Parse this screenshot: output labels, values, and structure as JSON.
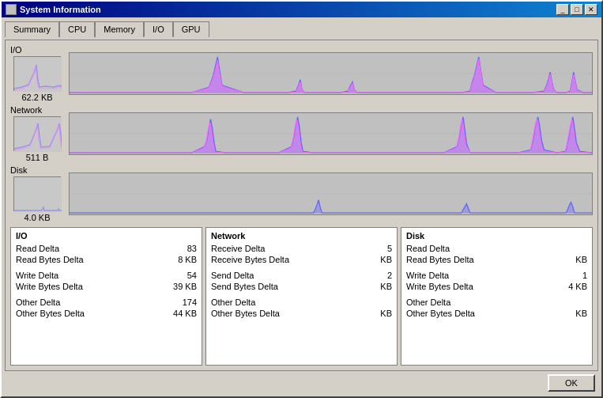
{
  "window": {
    "title": "System Information",
    "minimize_label": "0",
    "maximize_label": "1",
    "close_label": "r"
  },
  "tabs": [
    {
      "label": "Summary",
      "active": false
    },
    {
      "label": "CPU",
      "active": false
    },
    {
      "label": "Memory",
      "active": false
    },
    {
      "label": "I/O",
      "active": true
    },
    {
      "label": "GPU",
      "active": false
    }
  ],
  "sections": [
    {
      "name": "I/O",
      "value": "62.2  KB"
    },
    {
      "name": "Network",
      "value": "511  B"
    },
    {
      "name": "Disk",
      "value": "4.0  KB"
    }
  ],
  "stats": {
    "io": {
      "title": "I/O",
      "rows": [
        {
          "label": "Read Delta",
          "value": "83"
        },
        {
          "label": "Read Bytes Delta",
          "value": "8 KB"
        },
        {
          "label": "Write Delta",
          "value": "54"
        },
        {
          "label": "Write Bytes Delta",
          "value": "39 KB"
        },
        {
          "label": "Other Delta",
          "value": "174"
        },
        {
          "label": "Other Bytes Delta",
          "value": "44 KB"
        }
      ]
    },
    "network": {
      "title": "Network",
      "rows": [
        {
          "label": "Receive Delta",
          "value": "5"
        },
        {
          "label": "Receive Bytes Delta",
          "value": "KB"
        },
        {
          "label": "Send Delta",
          "value": "2"
        },
        {
          "label": "Send Bytes Delta",
          "value": "KB"
        },
        {
          "label": "Other Delta",
          "value": ""
        },
        {
          "label": "Other Bytes Delta",
          "value": "KB"
        }
      ]
    },
    "disk": {
      "title": "Disk",
      "rows": [
        {
          "label": "Read Delta",
          "value": ""
        },
        {
          "label": "Read Bytes Delta",
          "value": "KB"
        },
        {
          "label": "Write Delta",
          "value": "1"
        },
        {
          "label": "Write Bytes Delta",
          "value": "4 KB"
        },
        {
          "label": "Other Delta",
          "value": ""
        },
        {
          "label": "Other Bytes Delta",
          "value": "KB"
        }
      ]
    }
  },
  "buttons": {
    "ok": "OK"
  }
}
